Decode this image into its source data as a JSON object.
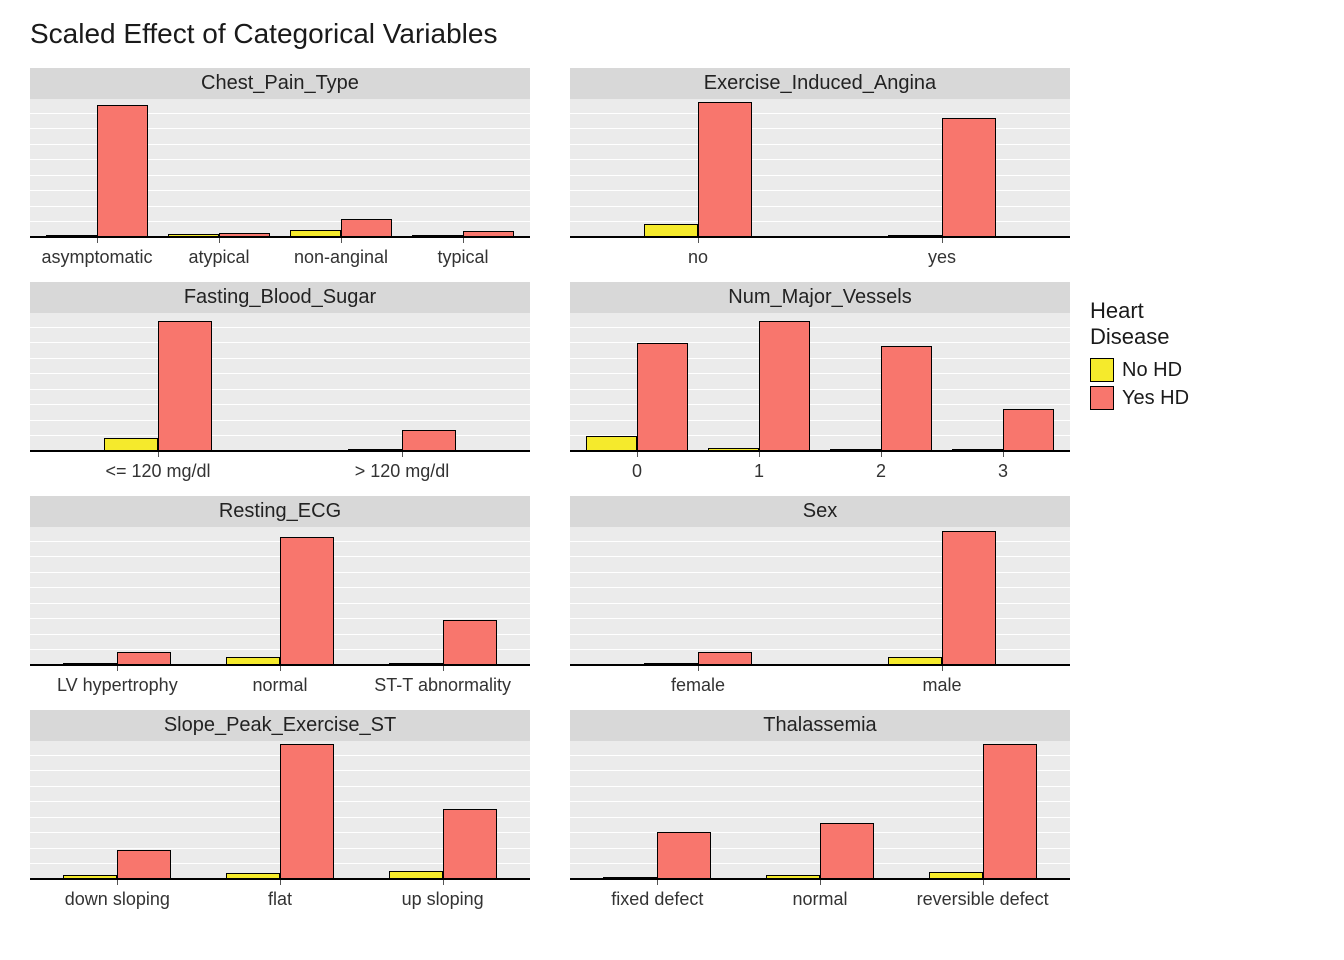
{
  "title": "Scaled Effect of Categorical Variables",
  "legend": {
    "title_line1": "Heart",
    "title_line2": "Disease",
    "items": [
      {
        "key": "no",
        "label": "No HD"
      },
      {
        "key": "yes",
        "label": "Yes HD"
      }
    ]
  },
  "colors": {
    "no": "#f5ea2c",
    "yes": "#f8766d",
    "panel_bg": "#ebebeb",
    "strip_bg": "#d8d8d8"
  },
  "chart_data": [
    {
      "facet": "Chest_Pain_Type",
      "type": "bar",
      "ylim": [
        0,
        1.0
      ],
      "categories": [
        "asymptomatic",
        "atypical",
        "non-anginal",
        "typical"
      ],
      "series": [
        {
          "name": "No HD",
          "key": "no",
          "values": [
            0.02,
            0.03,
            0.06,
            0.01
          ]
        },
        {
          "name": "Yes HD",
          "key": "yes",
          "values": [
            0.98,
            0.04,
            0.14,
            0.05
          ]
        }
      ]
    },
    {
      "facet": "Exercise_Induced_Angina",
      "type": "bar",
      "ylim": [
        0,
        1.0
      ],
      "categories": [
        "no",
        "yes"
      ],
      "series": [
        {
          "name": "No HD",
          "key": "no",
          "values": [
            0.1,
            0.02
          ]
        },
        {
          "name": "Yes HD",
          "key": "yes",
          "values": [
            1.0,
            0.88
          ]
        }
      ]
    },
    {
      "facet": "Fasting_Blood_Sugar",
      "type": "bar",
      "ylim": [
        0,
        1.0
      ],
      "categories": [
        "<= 120 mg/dl",
        "> 120 mg/dl"
      ],
      "series": [
        {
          "name": "No HD",
          "key": "no",
          "values": [
            0.1,
            0.01
          ]
        },
        {
          "name": "Yes HD",
          "key": "yes",
          "values": [
            0.96,
            0.16
          ]
        }
      ]
    },
    {
      "facet": "Num_Major_Vessels",
      "type": "bar",
      "ylim": [
        0,
        1.0
      ],
      "categories": [
        "0",
        "1",
        "2",
        "3"
      ],
      "series": [
        {
          "name": "No HD",
          "key": "no",
          "values": [
            0.12,
            0.03,
            0.02,
            0.01
          ]
        },
        {
          "name": "Yes HD",
          "key": "yes",
          "values": [
            0.8,
            0.96,
            0.78,
            0.32
          ]
        }
      ]
    },
    {
      "facet": "Resting_ECG",
      "type": "bar",
      "ylim": [
        0,
        1.0
      ],
      "categories": [
        "LV hypertrophy",
        "normal",
        "ST-T abnormality"
      ],
      "series": [
        {
          "name": "No HD",
          "key": "no",
          "values": [
            0.02,
            0.07,
            0.02
          ]
        },
        {
          "name": "Yes HD",
          "key": "yes",
          "values": [
            0.1,
            0.95,
            0.34
          ]
        }
      ]
    },
    {
      "facet": "Sex",
      "type": "bar",
      "ylim": [
        0,
        1.0
      ],
      "categories": [
        "female",
        "male"
      ],
      "series": [
        {
          "name": "No HD",
          "key": "no",
          "values": [
            0.01,
            0.07
          ]
        },
        {
          "name": "Yes HD",
          "key": "yes",
          "values": [
            0.1,
            0.99
          ]
        }
      ]
    },
    {
      "facet": "Slope_Peak_Exercise_ST",
      "type": "bar",
      "ylim": [
        0,
        1.0
      ],
      "categories": [
        "down sloping",
        "flat",
        "up sloping"
      ],
      "series": [
        {
          "name": "No HD",
          "key": "no",
          "values": [
            0.04,
            0.05,
            0.07
          ]
        },
        {
          "name": "Yes HD",
          "key": "yes",
          "values": [
            0.22,
            1.0,
            0.52
          ]
        }
      ]
    },
    {
      "facet": "Thalassemia",
      "type": "bar",
      "ylim": [
        0,
        1.0
      ],
      "categories": [
        "fixed defect",
        "normal",
        "reversible defect"
      ],
      "series": [
        {
          "name": "No HD",
          "key": "no",
          "values": [
            0.01,
            0.04,
            0.06
          ]
        },
        {
          "name": "Yes HD",
          "key": "yes",
          "values": [
            0.35,
            0.42,
            1.0
          ]
        }
      ]
    }
  ]
}
